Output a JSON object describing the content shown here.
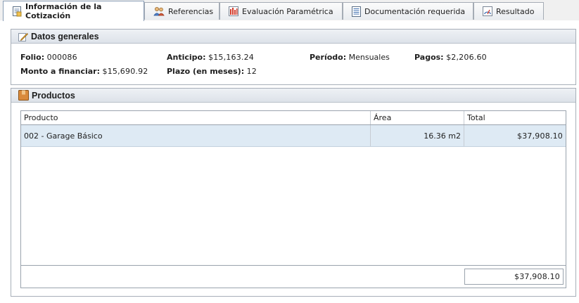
{
  "tabs": [
    {
      "label": "Información de la Cotización",
      "icon": "document-icon",
      "active": true
    },
    {
      "label": "Referencias",
      "icon": "people-icon",
      "active": false
    },
    {
      "label": "Evaluación Paramétrica",
      "icon": "bar-chart-icon",
      "active": false
    },
    {
      "label": "Documentación requerida",
      "icon": "checklist-icon",
      "active": false
    },
    {
      "label": "Resultado",
      "icon": "gauge-icon",
      "active": false
    }
  ],
  "datos_generales": {
    "title": "Datos generales",
    "folio_label": "Folio:",
    "folio_value": "000086",
    "anticipo_label": "Anticipo:",
    "anticipo_value": "$15,163.24",
    "periodo_label": "Período:",
    "periodo_value": "Mensuales",
    "pagos_label": "Pagos:",
    "pagos_value": "$2,206.60",
    "monto_label": "Monto a financiar:",
    "monto_value": "$15,690.92",
    "plazo_label": "Plazo (en meses):",
    "plazo_value": "12"
  },
  "productos": {
    "title": "Productos",
    "columns": [
      "Producto",
      "Área",
      "Total"
    ],
    "rows": [
      {
        "producto": "002 - Garage Básico",
        "area": "16.36 m2",
        "total": "$37,908.10"
      }
    ],
    "footer_total": "$37,908.10"
  },
  "colors": {
    "selected_row": "#deeaf4",
    "header_gradient_top": "#eef1f5",
    "border": "#a7aeb8"
  }
}
